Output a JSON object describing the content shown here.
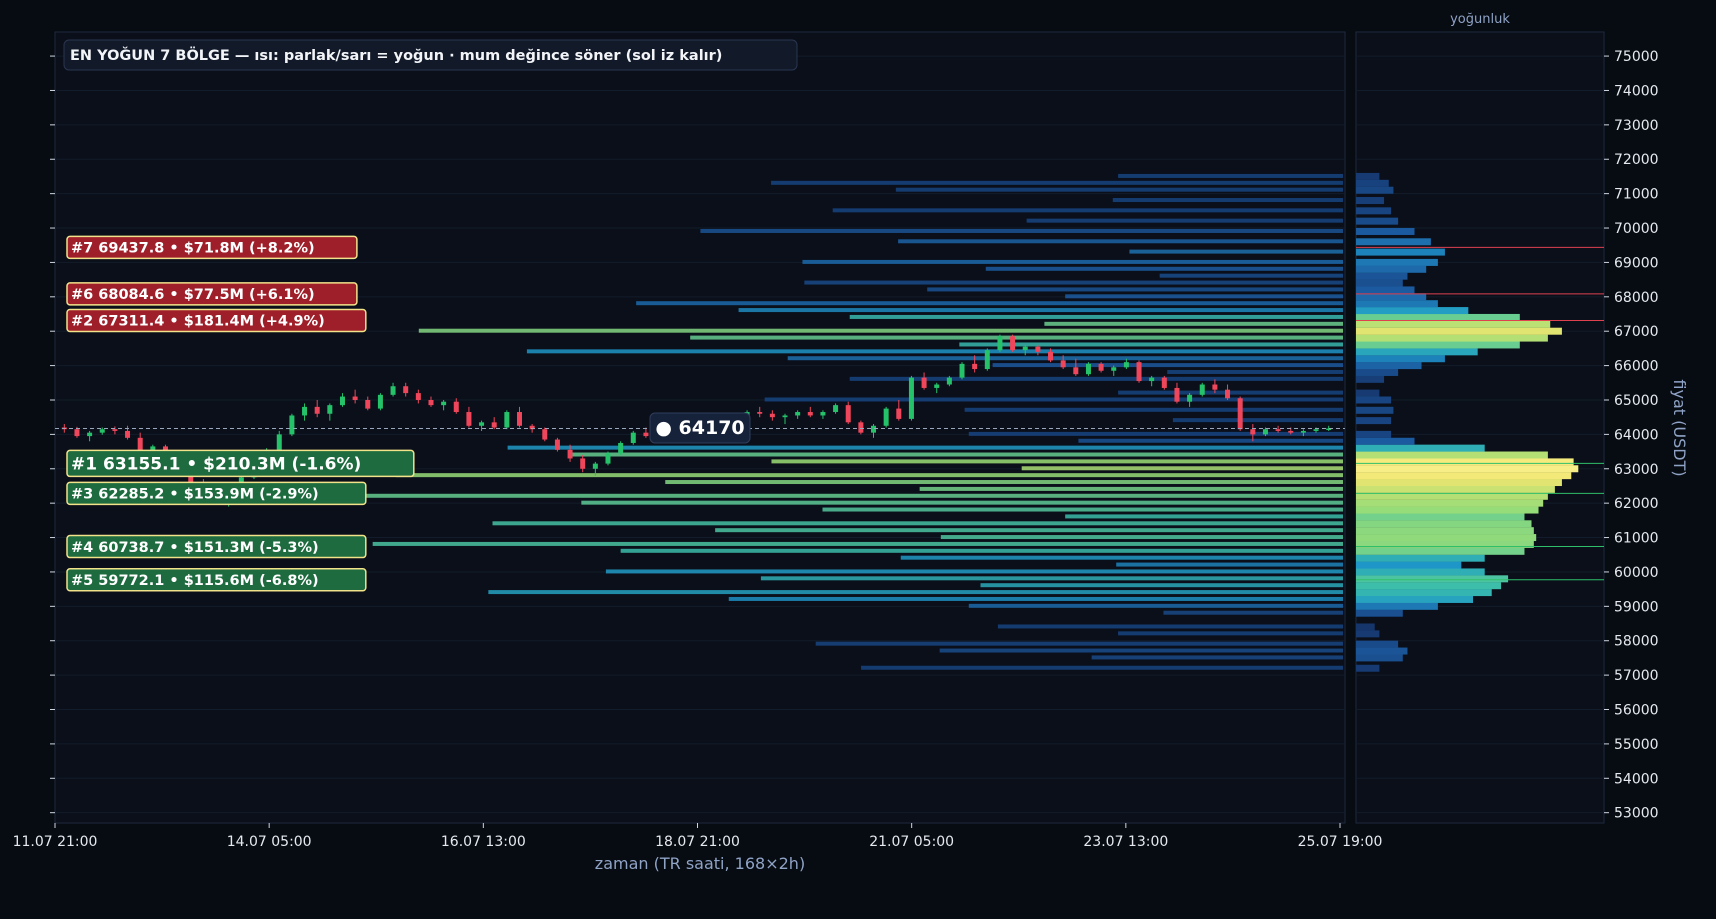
{
  "title": "EN YOĞUN 7 BÖLGE — ısı: parlak/sarı = yoğun · mum değince söner (sol iz kalır)",
  "xlabel": "zaman (TR saati, 168×2h)",
  "ylabel": "fiyat (USDT)",
  "side_panel_title": "yoğunluk",
  "current_price_label": "● 64170",
  "colors": {
    "background": "#070b12",
    "panel": "#0a0f1a",
    "up_candle": "#26c26a",
    "down_candle": "#f0465b",
    "label_green": "#1d6b3e",
    "label_red": "#9e1f2a",
    "label_border": "#f2e28a"
  },
  "chart_data": {
    "type": "heatmap",
    "title": "EN YOĞUN 7 BÖLGE — ısı: parlak/sarı = yoğun · mum değince söner (sol iz kalır)",
    "xlabel": "zaman (TR saati, 168×2h)",
    "ylabel": "fiyat (USDT)",
    "ylim": [
      52700,
      75700
    ],
    "y_ticks": [
      53000,
      54000,
      55000,
      56000,
      57000,
      58000,
      59000,
      60000,
      61000,
      62000,
      63000,
      64000,
      65000,
      66000,
      67000,
      68000,
      69000,
      70000,
      71000,
      72000,
      73000,
      74000,
      75000
    ],
    "x_ticks": [
      "11.07 21:00",
      "14.07 05:00",
      "16.07 13:00",
      "18.07 21:00",
      "21.07 05:00",
      "23.07 13:00",
      "25.07 19:00"
    ],
    "current_price": 64170,
    "zones": [
      {
        "label": "#7  69437.8  •  $71.8M  (+8.2%)",
        "price": 69437.8,
        "rank": 7,
        "side": "above"
      },
      {
        "label": "#6  68084.6  •  $77.5M  (+6.1%)",
        "price": 68084.6,
        "rank": 6,
        "side": "above"
      },
      {
        "label": "#2  67311.4  •  $181.4M  (+4.9%)",
        "price": 67311.4,
        "rank": 2,
        "side": "above"
      },
      {
        "label": "#1  63155.1  •  $210.3M  (-1.6%)",
        "price": 63155.1,
        "rank": 1,
        "side": "below"
      },
      {
        "label": "#3  62285.2  •  $153.9M  (-2.9%)",
        "price": 62285.2,
        "rank": 3,
        "side": "below"
      },
      {
        "label": "#4  60738.7  •  $151.3M  (-5.3%)",
        "price": 60738.7,
        "rank": 4,
        "side": "below"
      },
      {
        "label": "#5  59772.1  •  $115.6M  (-6.8%)",
        "price": 59772.1,
        "rank": 5,
        "side": "below"
      }
    ],
    "density_profile": [
      [
        57200,
        0.1
      ],
      [
        57500,
        0.2
      ],
      [
        57700,
        0.22
      ],
      [
        57900,
        0.18
      ],
      [
        58200,
        0.1
      ],
      [
        58400,
        0.08
      ],
      [
        58800,
        0.2
      ],
      [
        59000,
        0.35
      ],
      [
        59200,
        0.5
      ],
      [
        59400,
        0.58
      ],
      [
        59600,
        0.62
      ],
      [
        59800,
        0.65
      ],
      [
        60000,
        0.55
      ],
      [
        60200,
        0.45
      ],
      [
        60400,
        0.55
      ],
      [
        60600,
        0.72
      ],
      [
        60800,
        0.76
      ],
      [
        61000,
        0.77
      ],
      [
        61200,
        0.76
      ],
      [
        61400,
        0.75
      ],
      [
        61600,
        0.72
      ],
      [
        61800,
        0.78
      ],
      [
        62000,
        0.8
      ],
      [
        62200,
        0.82
      ],
      [
        62400,
        0.85
      ],
      [
        62600,
        0.88
      ],
      [
        62800,
        0.92
      ],
      [
        63000,
        0.95
      ],
      [
        63200,
        0.93
      ],
      [
        63400,
        0.82
      ],
      [
        63600,
        0.55
      ],
      [
        63800,
        0.25
      ],
      [
        64000,
        0.15
      ],
      [
        64400,
        0.15
      ],
      [
        64700,
        0.16
      ],
      [
        65000,
        0.15
      ],
      [
        65200,
        0.1
      ],
      [
        65600,
        0.12
      ],
      [
        65800,
        0.18
      ],
      [
        66000,
        0.28
      ],
      [
        66200,
        0.38
      ],
      [
        66400,
        0.52
      ],
      [
        66600,
        0.7
      ],
      [
        66800,
        0.82
      ],
      [
        67000,
        0.88
      ],
      [
        67200,
        0.83
      ],
      [
        67400,
        0.7
      ],
      [
        67600,
        0.48
      ],
      [
        67800,
        0.35
      ],
      [
        68000,
        0.3
      ],
      [
        68200,
        0.25
      ],
      [
        68400,
        0.2
      ],
      [
        68600,
        0.22
      ],
      [
        68800,
        0.3
      ],
      [
        69000,
        0.35
      ],
      [
        69300,
        0.38
      ],
      [
        69600,
        0.32
      ],
      [
        69900,
        0.25
      ],
      [
        70200,
        0.18
      ],
      [
        70500,
        0.15
      ],
      [
        70800,
        0.12
      ],
      [
        71100,
        0.16
      ],
      [
        71300,
        0.14
      ],
      [
        71500,
        0.1
      ]
    ],
    "candles": [
      [
        64200,
        64300,
        64050,
        64150
      ],
      [
        64150,
        64220,
        63900,
        63950
      ],
      [
        63950,
        64100,
        63800,
        64050
      ],
      [
        64050,
        64200,
        63990,
        64150
      ],
      [
        64150,
        64230,
        64000,
        64100
      ],
      [
        64100,
        64250,
        63850,
        63900
      ],
      [
        63900,
        64050,
        63500,
        63550
      ],
      [
        63550,
        63700,
        63300,
        63650
      ],
      [
        63650,
        63700,
        63000,
        63050
      ],
      [
        63050,
        63200,
        62800,
        62900
      ],
      [
        62900,
        63100,
        62400,
        62500
      ],
      [
        62500,
        62700,
        62200,
        62300
      ],
      [
        62300,
        62500,
        62000,
        62100
      ],
      [
        62100,
        62400,
        61900,
        62350
      ],
      [
        62350,
        62800,
        62300,
        62750
      ],
      [
        62750,
        63200,
        62700,
        63150
      ],
      [
        63150,
        63600,
        63100,
        63550
      ],
      [
        63550,
        64100,
        63500,
        64000
      ],
      [
        64000,
        64600,
        63950,
        64550
      ],
      [
        64550,
        64900,
        64400,
        64800
      ],
      [
        64800,
        65000,
        64500,
        64600
      ],
      [
        64600,
        64900,
        64400,
        64850
      ],
      [
        64850,
        65200,
        64800,
        65100
      ],
      [
        65100,
        65300,
        64900,
        65000
      ],
      [
        65000,
        65100,
        64700,
        64750
      ],
      [
        64750,
        65200,
        64700,
        65150
      ],
      [
        65150,
        65500,
        65100,
        65400
      ],
      [
        65400,
        65500,
        65100,
        65200
      ],
      [
        65200,
        65300,
        64900,
        65000
      ],
      [
        65000,
        65100,
        64800,
        64850
      ],
      [
        64850,
        65000,
        64700,
        64950
      ],
      [
        64950,
        65050,
        64600,
        64650
      ],
      [
        64650,
        64800,
        64200,
        64250
      ],
      [
        64250,
        64400,
        64100,
        64350
      ],
      [
        64350,
        64500,
        64150,
        64200
      ],
      [
        64200,
        64700,
        64150,
        64650
      ],
      [
        64650,
        64800,
        64200,
        64250
      ],
      [
        64250,
        64300,
        64050,
        64150
      ],
      [
        64150,
        64200,
        63800,
        63850
      ],
      [
        63850,
        63900,
        63500,
        63550
      ],
      [
        63550,
        63700,
        63200,
        63300
      ],
      [
        63300,
        63400,
        62900,
        63000
      ],
      [
        63000,
        63200,
        62800,
        63150
      ],
      [
        63150,
        63500,
        63100,
        63450
      ],
      [
        63450,
        63800,
        63400,
        63750
      ],
      [
        63750,
        64100,
        63700,
        64050
      ],
      [
        64050,
        64200,
        63900,
        63950
      ],
      [
        63950,
        64100,
        63850,
        64050
      ],
      [
        64050,
        64150,
        63950,
        64000
      ],
      [
        64000,
        64100,
        63950,
        64050
      ],
      [
        64050,
        64250,
        64000,
        64200
      ],
      [
        64200,
        64300,
        64100,
        64150
      ],
      [
        64150,
        64300,
        64100,
        64250
      ],
      [
        64250,
        64500,
        64200,
        64450
      ],
      [
        64450,
        64700,
        64400,
        64650
      ],
      [
        64650,
        64800,
        64500,
        64600
      ],
      [
        64600,
        64700,
        64400,
        64500
      ],
      [
        64500,
        64600,
        64300,
        64550
      ],
      [
        64550,
        64700,
        64450,
        64650
      ],
      [
        64650,
        64800,
        64500,
        64550
      ],
      [
        64550,
        64700,
        64450,
        64650
      ],
      [
        64650,
        64900,
        64600,
        64850
      ],
      [
        64850,
        64950,
        64300,
        64350
      ],
      [
        64350,
        64400,
        64000,
        64050
      ],
      [
        64050,
        64300,
        63900,
        64250
      ],
      [
        64250,
        64800,
        64200,
        64750
      ],
      [
        64750,
        65000,
        64400,
        64450
      ],
      [
        64450,
        65700,
        64400,
        65650
      ],
      [
        65650,
        65800,
        65300,
        65350
      ],
      [
        65350,
        65500,
        65200,
        65450
      ],
      [
        65450,
        65700,
        65400,
        65650
      ],
      [
        65650,
        66100,
        65600,
        66050
      ],
      [
        66050,
        66300,
        65800,
        65900
      ],
      [
        65900,
        66500,
        65850,
        66450
      ],
      [
        66450,
        66900,
        66400,
        66850
      ],
      [
        66850,
        66900,
        66400,
        66450
      ],
      [
        66450,
        66600,
        66300,
        66550
      ],
      [
        66550,
        66600,
        66300,
        66400
      ],
      [
        66400,
        66500,
        66100,
        66150
      ],
      [
        66150,
        66300,
        65900,
        65950
      ],
      [
        65950,
        66200,
        65700,
        65750
      ],
      [
        65750,
        66100,
        65700,
        66050
      ],
      [
        66050,
        66100,
        65800,
        65850
      ],
      [
        65850,
        66000,
        65700,
        65950
      ],
      [
        65950,
        66200,
        65900,
        66100
      ],
      [
        66100,
        66150,
        65500,
        65550
      ],
      [
        65550,
        65700,
        65400,
        65650
      ],
      [
        65650,
        65700,
        65300,
        65350
      ],
      [
        65350,
        65500,
        64900,
        64950
      ],
      [
        64950,
        65200,
        64800,
        65150
      ],
      [
        65150,
        65500,
        65100,
        65450
      ],
      [
        65450,
        65600,
        65200,
        65300
      ],
      [
        65300,
        65450,
        65000,
        65050
      ],
      [
        65050,
        65100,
        64100,
        64150
      ],
      [
        64150,
        64300,
        63800,
        64000
      ],
      [
        64000,
        64200,
        63950,
        64150
      ],
      [
        64150,
        64250,
        64050,
        64100
      ],
      [
        64100,
        64200,
        64000,
        64050
      ],
      [
        64050,
        64150,
        63950,
        64100
      ],
      [
        64100,
        64200,
        64050,
        64150
      ],
      [
        64150,
        64250,
        64100,
        64170
      ]
    ]
  }
}
